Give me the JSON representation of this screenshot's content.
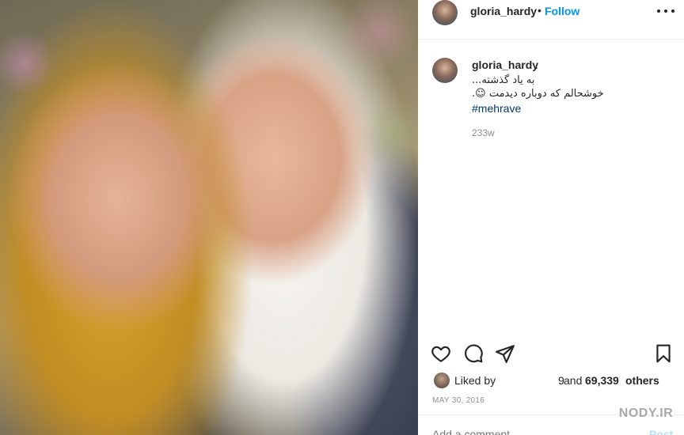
{
  "post": {
    "header": {
      "username": "gloria_hardy",
      "separator": "•",
      "follow_label": "Follow",
      "more_icon": "more-horizontal-icon"
    },
    "caption": {
      "username": "gloria_hardy",
      "username_suffix": ".",
      "line1": "به یاد گذشته...",
      "line2": "خوشحالم که دوباره دیدمت ☺.",
      "hashtag": "#mehrave",
      "age": "233w"
    },
    "actions": {
      "like_icon": "heart-icon",
      "comment_icon": "comment-icon",
      "share_icon": "send-icon",
      "save_icon": "bookmark-icon"
    },
    "likes": {
      "liked_by_label": "Liked by",
      "liker_name_fragment": "9",
      "and_label": "and",
      "count": "69,339",
      "others_label": "others"
    },
    "date": "MAY 30, 2016",
    "comment_box": {
      "placeholder": "Add a comment...",
      "post_label": "Post"
    }
  },
  "watermark": {
    "text": "NODY.IR"
  },
  "colors": {
    "accent": "#0095f6",
    "hashtag": "#00376b",
    "muted": "#8e8e8e",
    "post_disabled": "#b2dffc"
  }
}
